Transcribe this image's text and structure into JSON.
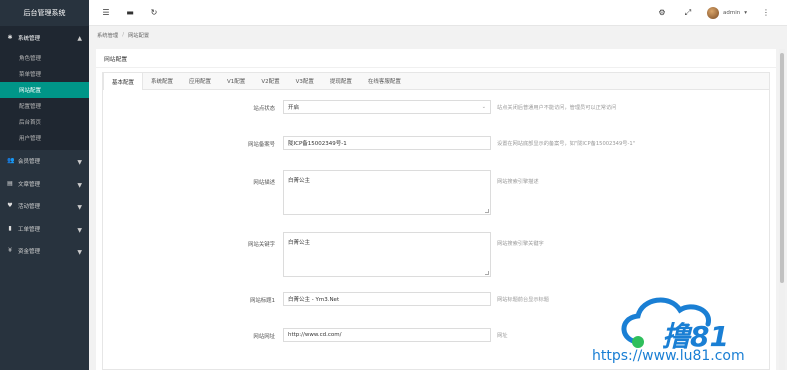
{
  "sidebar": {
    "title": "后台管理系统",
    "groups": [
      {
        "label": "系统管理",
        "icon": "gear-icon",
        "open": true,
        "items": [
          "角色管理",
          "菜单管理",
          "网站配置",
          "配置管理",
          "后台首页",
          "用户管理"
        ]
      },
      {
        "label": "会员管理",
        "icon": "users-icon"
      },
      {
        "label": "文章管理",
        "icon": "book-icon"
      },
      {
        "label": "活动管理",
        "icon": "heart-icon"
      },
      {
        "label": "工单管理",
        "icon": "document-icon"
      },
      {
        "label": "资金管理",
        "icon": "yen-icon"
      }
    ]
  },
  "header": {
    "icons": [
      "menu-toggle-icon",
      "keyboard-icon",
      "refresh-icon"
    ],
    "right_icons": [
      "theme-icon",
      "fullscreen-icon"
    ],
    "username": "admin",
    "more": "⋮"
  },
  "breadcrumb": [
    "系统管理",
    "网站配置"
  ],
  "card": {
    "title": "网站配置",
    "tabs": [
      "基本配置",
      "系统配置",
      "应用配置",
      "V1配置",
      "V2配置",
      "V3配置",
      "提现配置",
      "在线客服配置"
    ],
    "active_tab": 0
  },
  "form": {
    "site_status": {
      "label": "站点状态",
      "value": "开启",
      "hint": "站点关闭后普通用户不能访问，管理员可以正常访问"
    },
    "icp": {
      "label": "网站备案号",
      "value": "陇ICP备15002349号-1",
      "hint": "设置在网站底部显示的备案号，如\"陇ICP备15002349号-1\""
    },
    "description": {
      "label": "网站描述",
      "value": "白菁公主",
      "hint": "网站搜索引擎描述"
    },
    "keywords": {
      "label": "网站关键字",
      "value": "白菁公主",
      "hint": "网站搜索引擎关键字"
    },
    "site_title": {
      "label": "网站标题1",
      "value": "白菁公主 - Ym3.Net",
      "hint": "网站标题前台显示标题"
    },
    "site_url": {
      "label": "网站网址",
      "value": "http://www.cd.com/",
      "hint": "网址"
    }
  },
  "watermark": {
    "url": "https://www.lu81.com",
    "brand": "撸81"
  },
  "colors": {
    "sidebar_bg": "#28333e",
    "active": "#009688",
    "watermark": "#1a7fd4"
  }
}
